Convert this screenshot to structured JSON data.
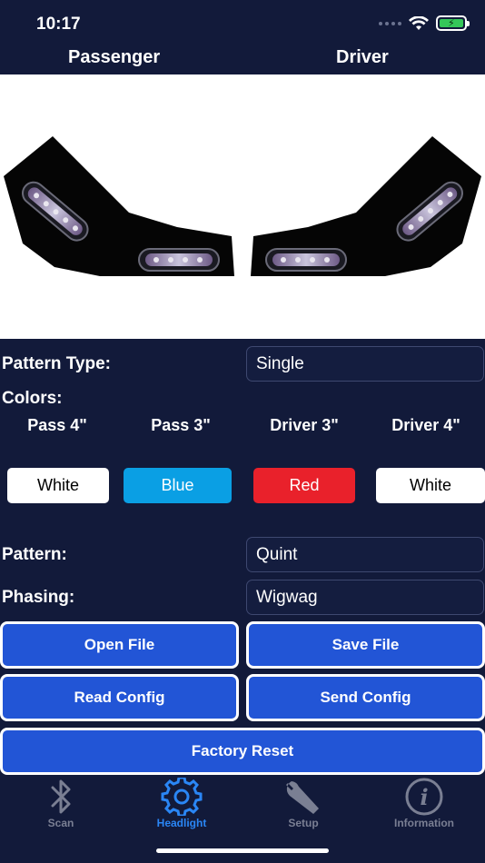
{
  "status_bar": {
    "time": "10:17"
  },
  "header": {
    "passenger_label": "Passenger",
    "driver_label": "Driver"
  },
  "pattern_type": {
    "label": "Pattern Type:",
    "value": "Single"
  },
  "colors": {
    "label": "Colors:",
    "columns": [
      {
        "label": "Pass 4\"",
        "value": "White",
        "bg": "#ffffff",
        "fg": "#000000"
      },
      {
        "label": "Pass 3\"",
        "value": "Blue",
        "bg": "#0a9fe4",
        "fg": "#ffffff"
      },
      {
        "label": "Driver 3\"",
        "value": "Red",
        "bg": "#e9212b",
        "fg": "#ffffff"
      },
      {
        "label": "Driver 4\"",
        "value": "White",
        "bg": "#ffffff",
        "fg": "#000000"
      }
    ]
  },
  "pattern": {
    "label": "Pattern:",
    "value": "Quint"
  },
  "phasing": {
    "label": "Phasing:",
    "value": "Wigwag"
  },
  "buttons": {
    "open_file": "Open File",
    "save_file": "Save File",
    "read_config": "Read Config",
    "send_config": "Send Config",
    "factory_reset": "Factory Reset"
  },
  "tabs": [
    {
      "label": "Scan",
      "icon": "bluetooth-icon",
      "active": false
    },
    {
      "label": "Headlight",
      "icon": "gear-icon",
      "active": true
    },
    {
      "label": "Setup",
      "icon": "wrench-icon",
      "active": false
    },
    {
      "label": "Information",
      "icon": "info-icon",
      "active": false
    }
  ],
  "theme": {
    "accent": "#2a86f5",
    "button_blue": "#2255d6",
    "inactive_tab": "#7a7f93",
    "background": "#121a3a"
  }
}
